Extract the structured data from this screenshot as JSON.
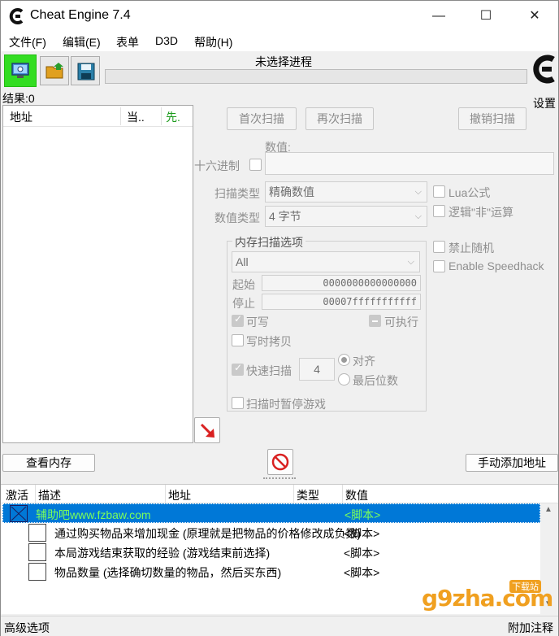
{
  "window": {
    "title": "Cheat Engine 7.4",
    "minimize": "—",
    "maximize": "☐",
    "close": "✕"
  },
  "menu": [
    "文件(F)",
    "编辑(E)",
    "表单",
    "D3D",
    "帮助(H)"
  ],
  "toolbar": {
    "process_label": "未选择进程",
    "settings_label": "设置"
  },
  "results": {
    "label": "结果:0"
  },
  "found_list": {
    "headers": [
      "地址",
      "当..",
      "先."
    ]
  },
  "scan": {
    "first_scan": "首次扫描",
    "next_scan": "再次扫描",
    "undo_scan": "撤销扫描",
    "value_label": "数值:",
    "hex_label": "十六进制",
    "value": "",
    "scan_type_label": "扫描类型",
    "scan_type_value": "精确数值",
    "value_type_label": "数值类型",
    "value_type_value": "4 字节",
    "lua_formula": "Lua公式",
    "not_logic": "逻辑\"非\"运算",
    "no_random": "禁止随机",
    "speedhack": "Enable Speedhack"
  },
  "mem_options": {
    "title": "内存扫描选项",
    "region": "All",
    "start_label": "起始",
    "start_value": "0000000000000000",
    "stop_label": "停止",
    "stop_value": "00007fffffffffff",
    "writable": "可写",
    "executable": "可执行",
    "copy_on_write": "写时拷贝",
    "fast_scan": "快速扫描",
    "fast_scan_value": "4",
    "align": "对齐",
    "last_digits": "最后位数",
    "pause_game": "扫描时暂停游戏"
  },
  "buttons": {
    "view_memory": "查看内存",
    "add_address": "手动添加地址"
  },
  "address_table": {
    "headers": [
      "激活",
      "描述",
      "地址",
      "类型",
      "数值"
    ],
    "rows": [
      {
        "description": "辅助吧www.fzbaw.com",
        "value": "<脚本>",
        "selected": true
      },
      {
        "description": "通过购买物品来增加现金 (原理就是把物品的价格修改成负数)",
        "value": "<脚本>",
        "selected": false
      },
      {
        "description": "本局游戏结束获取的经验 (游戏结束前选择)",
        "value": "<脚本>",
        "selected": false
      },
      {
        "description": "物品数量 (选择确切数量的物品，然后买东西)",
        "value": "<脚本>",
        "selected": false
      }
    ]
  },
  "watermark": {
    "text": "g9zha.com",
    "badge": "下载站"
  },
  "status": {
    "advanced": "高级选项",
    "comments": "附加注释"
  },
  "colors": {
    "accent_green": "#33dd22",
    "selection_blue": "#0078d7",
    "row_green_text": "#7cff5a",
    "stop_red": "#d92020"
  }
}
